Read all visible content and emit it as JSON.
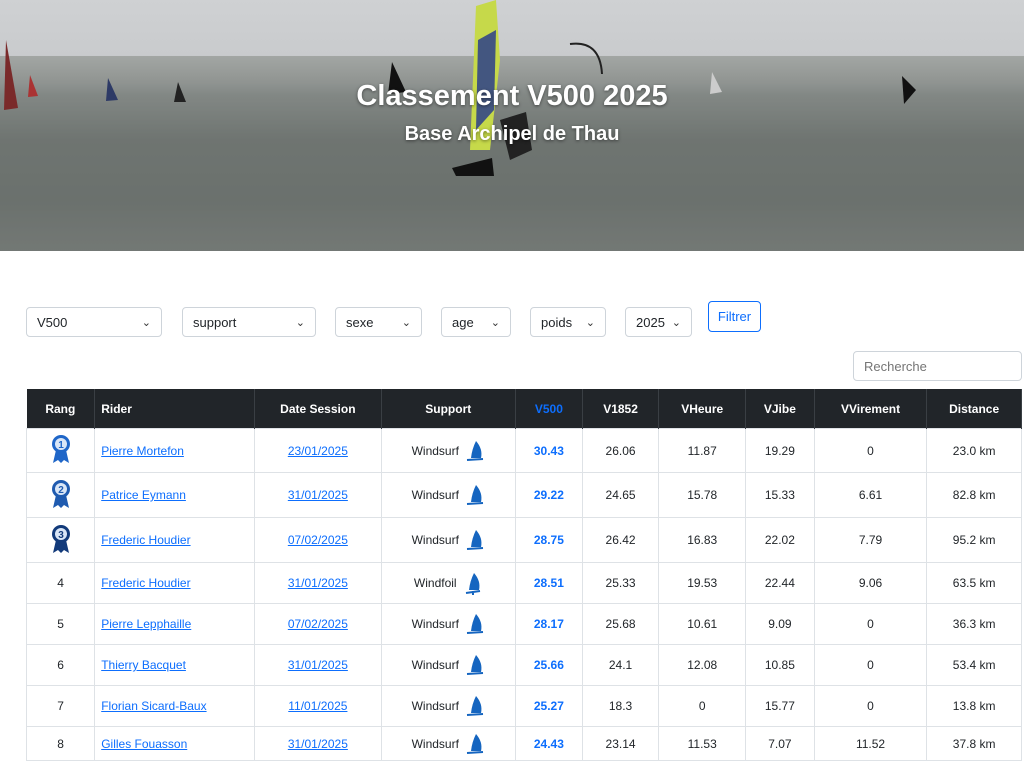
{
  "hero": {
    "title": "Classement V500 2025",
    "subtitle": "Base Archipel de Thau"
  },
  "filters": {
    "category": "V500",
    "support": "support",
    "sexe": "sexe",
    "age": "age",
    "poids": "poids",
    "year": "2025",
    "button": "Filtrer"
  },
  "search": {
    "placeholder": "Recherche"
  },
  "table": {
    "headers": [
      "Rang",
      "Rider",
      "Date Session",
      "Support",
      "V500",
      "V1852",
      "VHeure",
      "VJibe",
      "VVirement",
      "Distance"
    ],
    "rows": [
      {
        "rank": "1",
        "rider": "Pierre Mortefon",
        "date": "23/01/2025",
        "support": "Windsurf",
        "v500": "30.43",
        "v1852": "26.06",
        "vheure": "11.87",
        "vjibe": "19.29",
        "vvirement": "0",
        "distance": "23.0 km"
      },
      {
        "rank": "2",
        "rider": "Patrice Eymann",
        "date": "31/01/2025",
        "support": "Windsurf",
        "v500": "29.22",
        "v1852": "24.65",
        "vheure": "15.78",
        "vjibe": "15.33",
        "vvirement": "6.61",
        "distance": "82.8 km"
      },
      {
        "rank": "3",
        "rider": "Frederic Houdier",
        "date": "07/02/2025",
        "support": "Windsurf",
        "v500": "28.75",
        "v1852": "26.42",
        "vheure": "16.83",
        "vjibe": "22.02",
        "vvirement": "7.79",
        "distance": "95.2 km"
      },
      {
        "rank": "4",
        "rider": "Frederic Houdier",
        "date": "31/01/2025",
        "support": "Windfoil",
        "v500": "28.51",
        "v1852": "25.33",
        "vheure": "19.53",
        "vjibe": "22.44",
        "vvirement": "9.06",
        "distance": "63.5 km"
      },
      {
        "rank": "5",
        "rider": "Pierre Lepphaille",
        "date": "07/02/2025",
        "support": "Windsurf",
        "v500": "28.17",
        "v1852": "25.68",
        "vheure": "10.61",
        "vjibe": "9.09",
        "vvirement": "0",
        "distance": "36.3 km"
      },
      {
        "rank": "6",
        "rider": "Thierry Bacquet",
        "date": "31/01/2025",
        "support": "Windsurf",
        "v500": "25.66",
        "v1852": "24.1",
        "vheure": "12.08",
        "vjibe": "10.85",
        "vvirement": "0",
        "distance": "53.4 km"
      },
      {
        "rank": "7",
        "rider": "Florian Sicard-Baux",
        "date": "11/01/2025",
        "support": "Windsurf",
        "v500": "25.27",
        "v1852": "18.3",
        "vheure": "0",
        "vjibe": "15.77",
        "vvirement": "0",
        "distance": "13.8 km"
      },
      {
        "rank": "8",
        "rider": "Gilles Fouasson",
        "date": "31/01/2025",
        "support": "Windsurf",
        "v500": "24.43",
        "v1852": "23.14",
        "vheure": "11.53",
        "vjibe": "7.07",
        "vvirement": "11.52",
        "distance": "37.8 km"
      }
    ]
  },
  "colors": {
    "accent": "#0d6efd",
    "header_bg": "#212529",
    "icon": "#1565c0"
  }
}
